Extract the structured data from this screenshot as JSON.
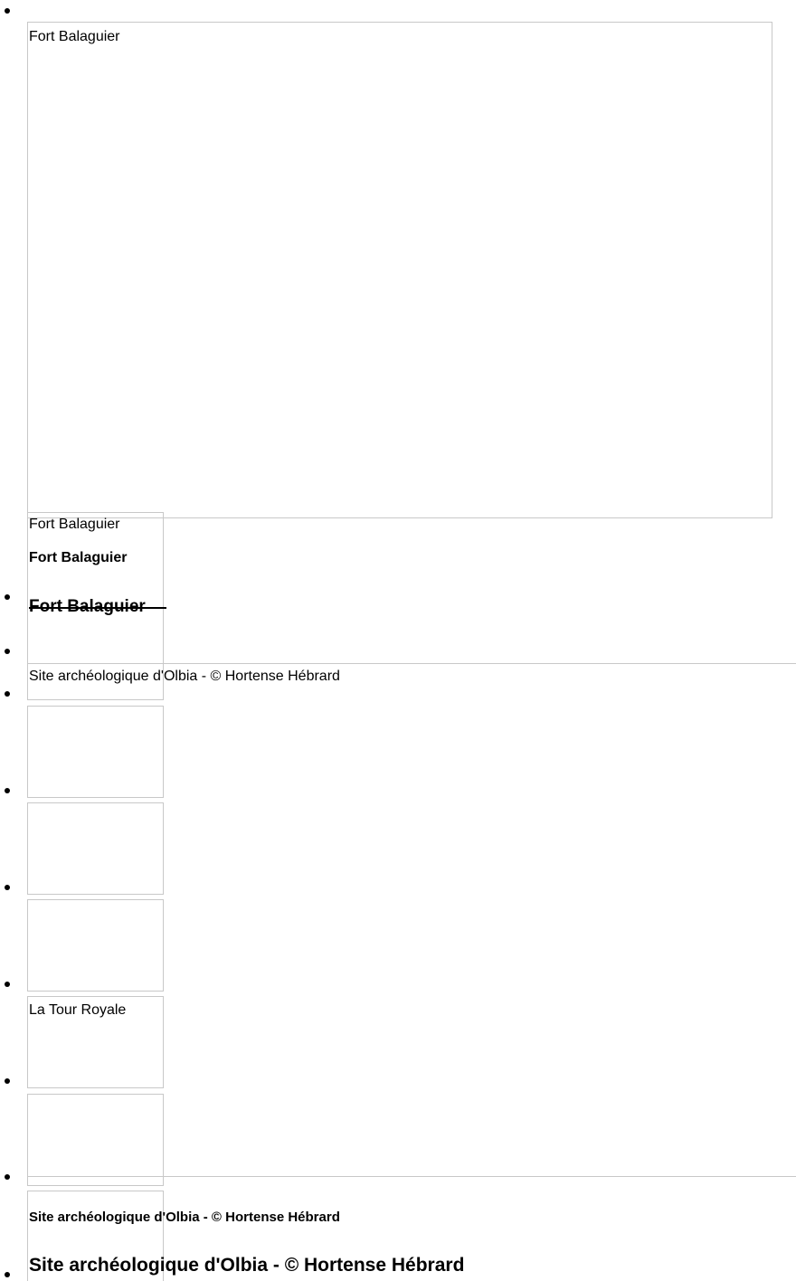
{
  "main_slide": {
    "alt_text": "Fort Balaguier"
  },
  "caption": {
    "small": "Fort Balaguier",
    "bold": "Fort Balaguier",
    "heading": "Fort Balaguier"
  },
  "slide_olbia": {
    "alt_text": "Site archéologique d'Olbia - © Hortense Hébrard"
  },
  "slide_tour": {
    "alt_text": "La Tour Royale"
  },
  "caption_olbia": {
    "bold": "Site archéologique d'Olbia - © Hortense Hébrard",
    "heading": "Site archéologique d'Olbia - © Hortense Hébrard"
  }
}
